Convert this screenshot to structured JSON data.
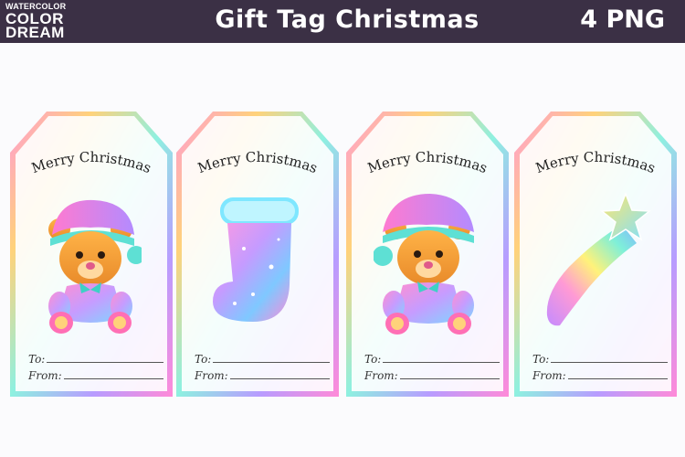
{
  "header": {
    "logo": {
      "line1": "WATERCOLOR",
      "line2": "COLOR",
      "line3": "DREAM"
    },
    "title": "Gift Tag Christmas",
    "count": "4 PNG",
    "background": "#3b3045"
  },
  "tags": [
    {
      "greeting": "Merry Christmas",
      "to_label": "To:",
      "from_label": "From:",
      "art": "teddy-bear-icon"
    },
    {
      "greeting": "Merry Christmas",
      "to_label": "To:",
      "from_label": "From:",
      "art": "stocking-icon"
    },
    {
      "greeting": "Merry Christmas",
      "to_label": "To:",
      "from_label": "From:",
      "art": "teddy-bear-icon"
    },
    {
      "greeting": "Merry Christmas",
      "to_label": "To:",
      "from_label": "From:",
      "art": "shooting-star-icon"
    }
  ]
}
